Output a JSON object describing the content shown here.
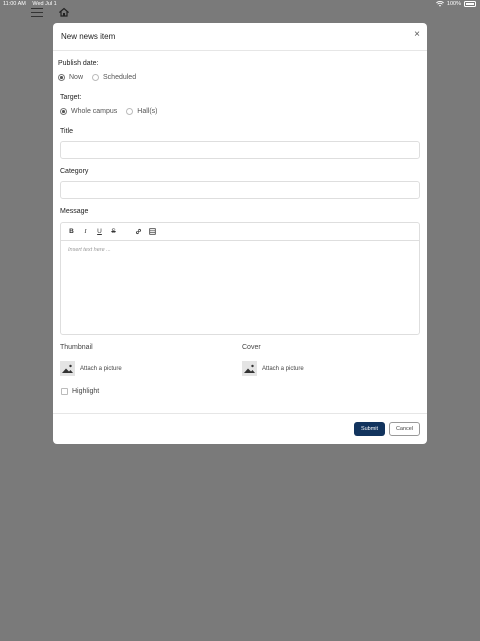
{
  "status_bar": {
    "time": "11:00 AM",
    "date": "Wed Jul 1",
    "battery": "100%"
  },
  "modal": {
    "title": "New news item",
    "close_symbol": "×",
    "publish_date": {
      "label": "Publish date:",
      "options": [
        {
          "label": "Now",
          "checked": true
        },
        {
          "label": "Scheduled",
          "checked": false
        }
      ]
    },
    "target": {
      "label": "Target:",
      "options": [
        {
          "label": "Whole campus",
          "checked": true
        },
        {
          "label": "Hall(s)",
          "checked": false
        }
      ]
    },
    "title_field": {
      "label": "Title",
      "value": "",
      "placeholder": ""
    },
    "category_field": {
      "label": "Category",
      "value": "",
      "placeholder": ""
    },
    "message": {
      "label": "Message",
      "toolbar": {
        "bold": "B",
        "italic": "I",
        "underline": "U",
        "strike": "S"
      },
      "placeholder": "Insert text here ..."
    },
    "thumbnail": {
      "label": "Thumbnail",
      "attach_label": "Attach a picture"
    },
    "cover": {
      "label": "Cover",
      "attach_label": "Attach a picture"
    },
    "highlight": {
      "label": "Highlight",
      "checked": false
    },
    "footer": {
      "submit_label": "Submit",
      "cancel_label": "Cancel"
    }
  },
  "colors": {
    "overlay": "#7a7a7a",
    "submit_bg": "#12345e"
  }
}
